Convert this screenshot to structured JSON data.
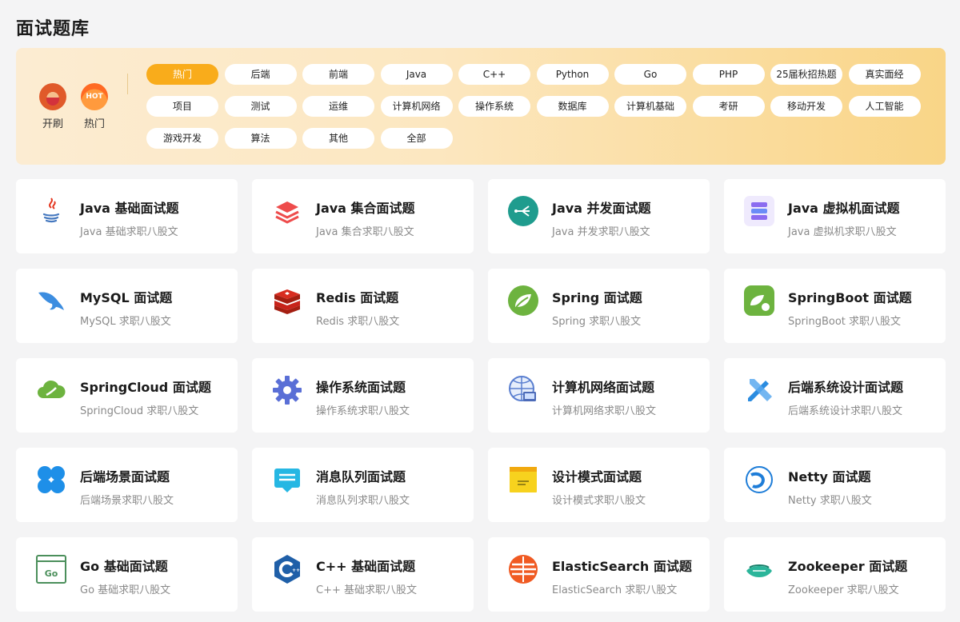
{
  "page": {
    "title": "面试题库"
  },
  "quick_actions": [
    {
      "label": "开刷",
      "icon": "start-mascot-icon"
    },
    {
      "label": "热门",
      "icon": "hot-flame-icon",
      "badge": "HOT"
    }
  ],
  "categories": [
    {
      "label": "热门",
      "active": true
    },
    {
      "label": "后端"
    },
    {
      "label": "前端"
    },
    {
      "label": "Java"
    },
    {
      "label": "C++"
    },
    {
      "label": "Python"
    },
    {
      "label": "Go"
    },
    {
      "label": "PHP"
    },
    {
      "label": "25届秋招热题"
    },
    {
      "label": "真实面经"
    },
    {
      "label": "项目"
    },
    {
      "label": "测试"
    },
    {
      "label": "运维"
    },
    {
      "label": "计算机网络"
    },
    {
      "label": "操作系统"
    },
    {
      "label": "数据库"
    },
    {
      "label": "计算机基础"
    },
    {
      "label": "考研"
    },
    {
      "label": "移动开发"
    },
    {
      "label": "人工智能"
    },
    {
      "label": "游戏开发"
    },
    {
      "label": "算法"
    },
    {
      "label": "其他"
    },
    {
      "label": "全部"
    }
  ],
  "question_banks": [
    {
      "title": "Java 基础面试题",
      "subtitle": "Java 基础求职八股文",
      "icon": "java-icon"
    },
    {
      "title": "Java 集合面试题",
      "subtitle": "Java 集合求职八股文",
      "icon": "layers-icon"
    },
    {
      "title": "Java 并发面试题",
      "subtitle": "Java 并发求职八股文",
      "icon": "concurrency-icon"
    },
    {
      "title": "Java 虚拟机面试题",
      "subtitle": "Java 虚拟机求职八股文",
      "icon": "server-icon"
    },
    {
      "title": "MySQL 面试题",
      "subtitle": "MySQL 求职八股文",
      "icon": "mysql-dolphin-icon"
    },
    {
      "title": "Redis 面试题",
      "subtitle": "Redis 求职八股文",
      "icon": "redis-icon"
    },
    {
      "title": "Spring 面试题",
      "subtitle": "Spring 求职八股文",
      "icon": "spring-leaf-icon"
    },
    {
      "title": "SpringBoot 面试题",
      "subtitle": "SpringBoot 求职八股文",
      "icon": "springboot-icon"
    },
    {
      "title": "SpringCloud 面试题",
      "subtitle": "SpringCloud 求职八股文",
      "icon": "springcloud-icon"
    },
    {
      "title": "操作系统面试题",
      "subtitle": "操作系统求职八股文",
      "icon": "gear-icon"
    },
    {
      "title": "计算机网络面试题",
      "subtitle": "计算机网络求职八股文",
      "icon": "network-globe-icon"
    },
    {
      "title": "后端系统设计面试题",
      "subtitle": "后端系统设计求职八股文",
      "icon": "design-tools-icon"
    },
    {
      "title": "后端场景面试题",
      "subtitle": "后端场景求职八股文",
      "icon": "clover-icon"
    },
    {
      "title": "消息队列面试题",
      "subtitle": "消息队列求职八股文",
      "icon": "message-icon"
    },
    {
      "title": "设计模式面试题",
      "subtitle": "设计模式求职八股文",
      "icon": "window-icon"
    },
    {
      "title": "Netty 面试题",
      "subtitle": "Netty 求职八股文",
      "icon": "netty-icon"
    },
    {
      "title": "Go 基础面试题",
      "subtitle": "Go 基础求职八股文",
      "icon": "go-window-icon"
    },
    {
      "title": "C++ 基础面试题",
      "subtitle": "C++ 基础求职八股文",
      "icon": "cpp-icon"
    },
    {
      "title": "ElasticSearch 面试题",
      "subtitle": "ElasticSearch 求职八股文",
      "icon": "elasticsearch-icon"
    },
    {
      "title": "Zookeeper 面试题",
      "subtitle": "Zookeeper 求职八股文",
      "icon": "zookeeper-icon"
    }
  ],
  "colors": {
    "accent": "#f9ac1b",
    "banner_start": "#fcecd2",
    "banner_end": "#f9d587"
  }
}
